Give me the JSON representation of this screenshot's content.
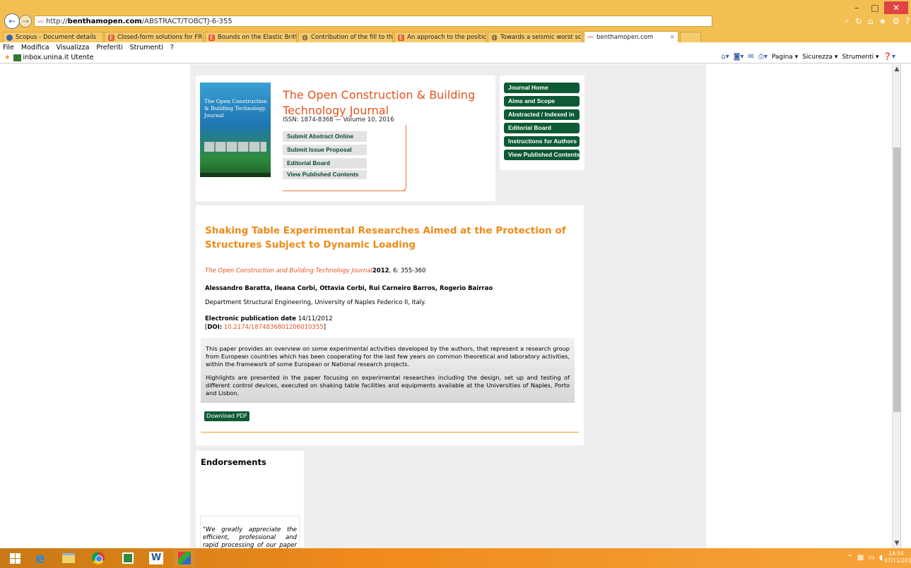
{
  "browser": {
    "url_prefix": "http://",
    "url_domain": "benthamopen.com",
    "url_path": "/ABSTRACT/TOBCTJ-6-355",
    "tabs": [
      {
        "label": "Scopus - Document details",
        "icon": "circle"
      },
      {
        "label": "Closed-form solutions for FRP ...",
        "icon": "eb"
      },
      {
        "label": "Bounds on the Elastic Brittle so...",
        "icon": "eb"
      },
      {
        "label": "Contribution of the fill to the s...",
        "icon": "glob"
      },
      {
        "label": "An approach to the positionin...",
        "icon": "eb"
      },
      {
        "label": "Towards a seismic worst scena...",
        "icon": "glob"
      },
      {
        "label": "benthamopen.com",
        "icon": "bo",
        "active": true,
        "close": "×"
      }
    ],
    "menu": [
      "File",
      "Modifica",
      "Visualizza",
      "Preferiti",
      "Strumenti",
      "?"
    ],
    "favorites": {
      "site": "inbox.unina.it",
      "label": "Utente"
    },
    "command_bar": {
      "page": "Pagina ▾",
      "safety": "Sicurezza ▾",
      "tools": "Strumenti ▾"
    }
  },
  "journal": {
    "cover_title": "The Open Construction & Building Technology Journal",
    "title_line1": "The Open Construction & Building",
    "title_line2": "Technology Journal",
    "issn": "ISSN: 1874-8368 — Volume 10, 2016",
    "submenu": [
      "Submit Abstract Online",
      "Submit Issue Proposal",
      "Editorial Board",
      "View Published Contents"
    ],
    "nav": [
      "Journal Home",
      "Aims and Scope",
      "Abstracted / Indexed in",
      "Editorial Board",
      "Instructions for Authors",
      "View Published Contents"
    ]
  },
  "article": {
    "title": "Shaking Table Experimental Researches Aimed at the Protection of Structures Subject to Dynamic Loading",
    "journal_name": "The Open Construction and Building Technology Journal",
    "year": "2012",
    "pages": ", 6: 355-360",
    "authors": "Alessandro Baratta, Ileana Corbi, Ottavia Corbi, Rui Carneiro Barros, Rogerio Bairrao",
    "department": "Department Structural Engineering, University of Naples Federico II, Italy.",
    "pub_label": "Electronic publication date",
    "pub_date": "14/11/2012",
    "doi_label": "DOI:",
    "doi": "10.2174/1874836801206010355",
    "abstract_p1": "This paper provides an overview on some experimental activities developed by the authors, that represent a research group from European countries which has been cooperating for the last few years on common theoretical and laboratory activities, within the framework of some European or National research projects.",
    "abstract_p2": "Highlights are presented in the paper focusing on experimental researches including the design, set up and testing of different control devices, executed on shaking table facilities and equipments available at the Universities of Naples, Porto and Lisbon.",
    "download": "Download PDF"
  },
  "endorsements": {
    "title": "Endorsements",
    "quote": "\"We greatly appreciate the efficient, professional and rapid processing of our paper by your team.\""
  },
  "taskbar": {
    "time": "14:54",
    "date": "07/11/2016"
  },
  "colors": {
    "chrome": "#f4bf52",
    "journal_orange": "#e5531e",
    "title_orange": "#ee8a18",
    "green": "#0d5a34",
    "page_bg": "#efeeee"
  }
}
